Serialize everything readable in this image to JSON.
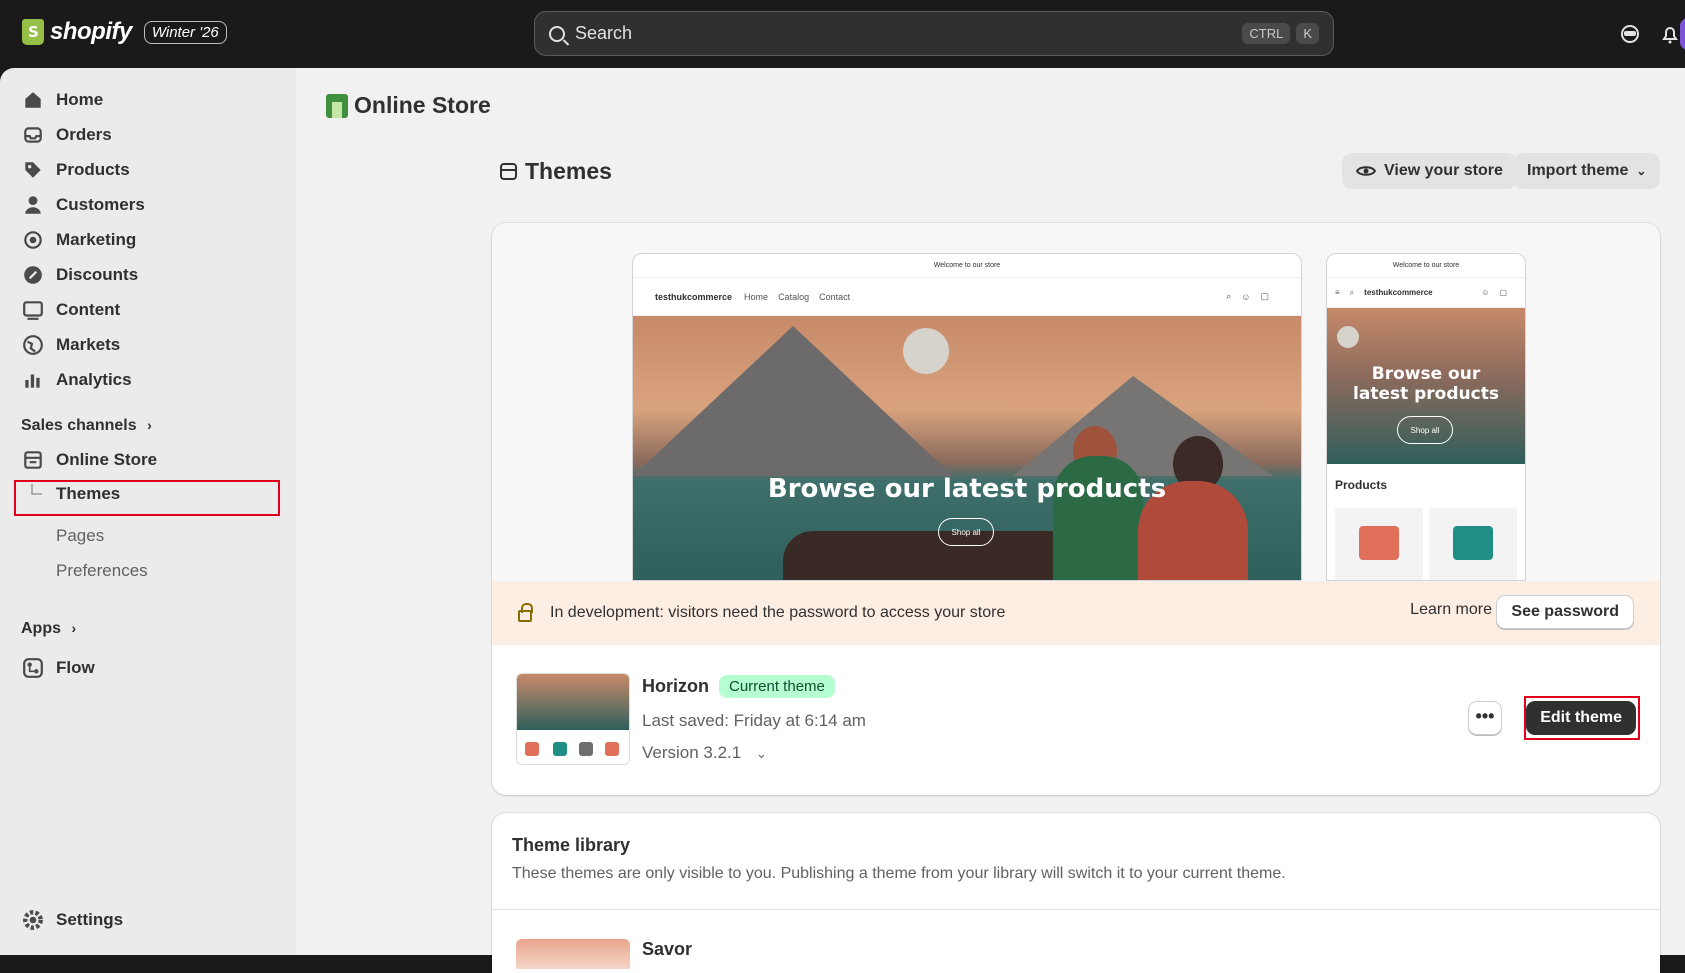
{
  "topbar": {
    "brand": "shopify",
    "edition": "Winter '26",
    "search_placeholder": "Search",
    "shortcut_keys": [
      "CTRL",
      "K"
    ]
  },
  "sidebar": {
    "items": [
      {
        "label": "Home",
        "icon": "home-icon"
      },
      {
        "label": "Orders",
        "icon": "inbox-icon"
      },
      {
        "label": "Products",
        "icon": "tag-icon"
      },
      {
        "label": "Customers",
        "icon": "person-icon"
      },
      {
        "label": "Marketing",
        "icon": "target-icon"
      },
      {
        "label": "Discounts",
        "icon": "discount-icon"
      },
      {
        "label": "Content",
        "icon": "image-icon"
      },
      {
        "label": "Markets",
        "icon": "globe-icon"
      },
      {
        "label": "Analytics",
        "icon": "bar-chart-icon"
      }
    ],
    "sales_channels_label": "Sales channels",
    "online_store_label": "Online Store",
    "sub_items": [
      "Themes",
      "Pages",
      "Preferences"
    ],
    "apps_label": "Apps",
    "flow_label": "Flow",
    "settings_label": "Settings"
  },
  "main": {
    "page_title": "Online Store",
    "section_title": "Themes",
    "view_store_label": "View your store",
    "import_theme_label": "Import theme",
    "preview": {
      "announcement": "Welcome to our store",
      "store_name": "testhukcommerce",
      "nav_links": [
        "Home",
        "Catalog",
        "Contact"
      ],
      "hero_title": "Browse our latest products",
      "mobile_hero_title": "Browse our latest products",
      "shop_all": "Shop all",
      "products_heading": "Products"
    },
    "dev_banner": {
      "text": "In development: visitors need the password to access your store",
      "learn_more": "Learn more",
      "see_password": "See password"
    },
    "current_theme": {
      "name": "Horizon",
      "badge": "Current theme",
      "last_saved": "Last saved: Friday at 6:14 am",
      "version": "Version 3.2.1",
      "more_label": "•••",
      "edit_label": "Edit theme"
    },
    "library": {
      "title": "Theme library",
      "description": "These themes are only visible to you. Publishing a theme from your library will switch it to your current theme.",
      "first_theme": "Savor"
    }
  },
  "colors": {
    "topbar": "#1a1a1a",
    "highlight": "#e0001b",
    "badge_bg": "#b4fed2",
    "banner_bg": "#fdeee3"
  }
}
